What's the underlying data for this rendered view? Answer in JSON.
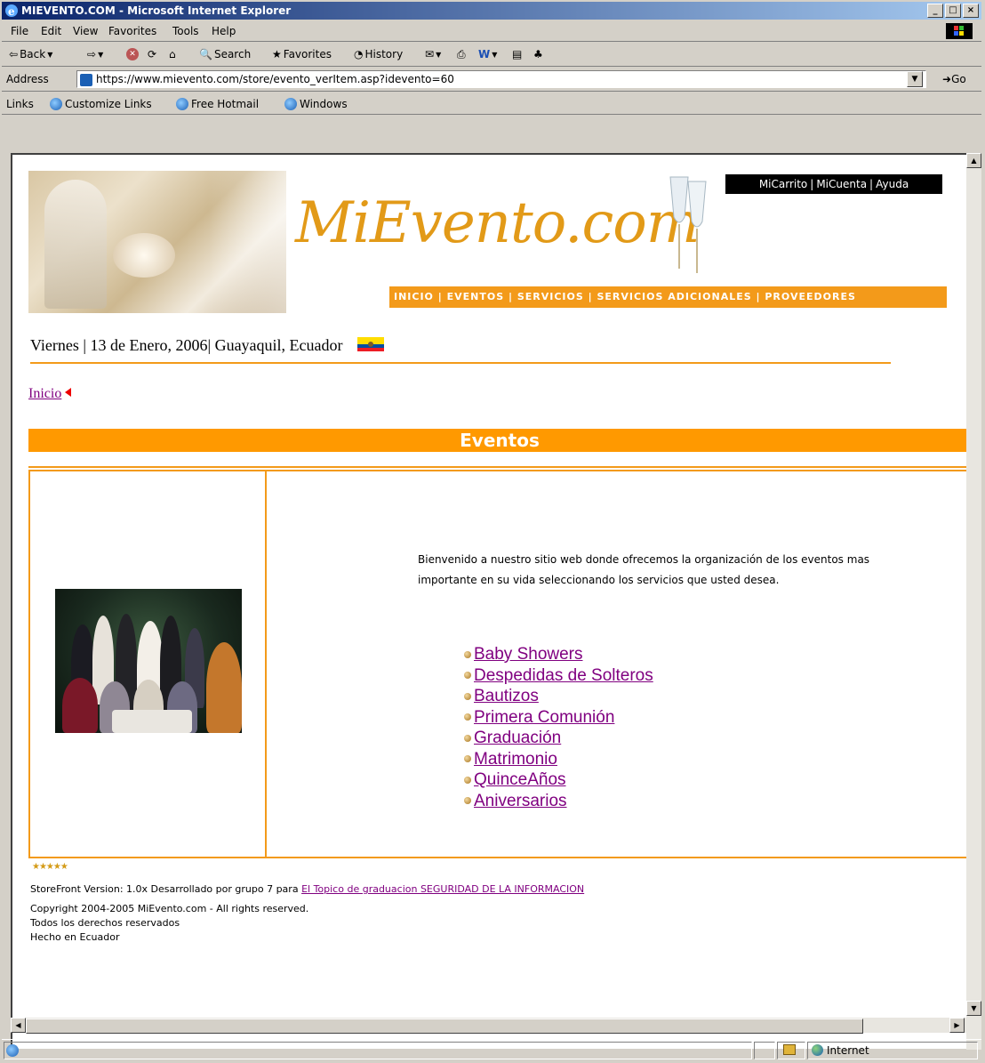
{
  "window": {
    "title": "MIEVENTO.COM - Microsoft Internet Explorer",
    "controls": [
      "_",
      "□",
      "×"
    ]
  },
  "menubar": {
    "items": [
      "File",
      "Edit",
      "View",
      "Favorites",
      "Tools",
      "Help"
    ]
  },
  "toolbar": {
    "back": "Back",
    "search": "Search",
    "favorites": "Favorites",
    "history": "History"
  },
  "address": {
    "label": "Address",
    "url": "https://www.mievento.com/store/evento_verItem.asp?idevento=60",
    "go": "Go"
  },
  "links": {
    "label": "Links",
    "items": [
      "Customize Links",
      "Free Hotmail",
      "Windows"
    ]
  },
  "site": {
    "logo": "MiEvento.com",
    "top_links": [
      "MiCarrito",
      "MiCuenta",
      "Ayuda"
    ],
    "nav": [
      "INICIO",
      "EVENTOS",
      "SERVICIOS",
      "SERVICIOS ADICIONALES",
      "PROVEEDORES"
    ],
    "dateline": "Viernes | 13 de Enero, 2006| Guayaquil, Ecuador",
    "breadcrumb": "Inicio",
    "section_title": "Eventos",
    "welcome_line1": "Bienvenido a nuestro sitio web donde ofrecemos la organización de los eventos mas",
    "welcome_line2": "importante en su vida seleccionando los servicios que usted desea.",
    "events": [
      "Baby Showers",
      "Despedidas de Solteros",
      "Bautizos",
      "Primera Comunión",
      "Graduación",
      "Matrimonio",
      "QuinceAños",
      "Aniversarios"
    ],
    "stars": "★★★★★",
    "footer": {
      "version_prefix": "StoreFront Version: 1.0x Desarrollado por grupo 7 para",
      "version_link": "El Topico de graduacion SEGURIDAD DE LA INFORMACION",
      "copyright": "Copyright 2004-2005 MiEvento.com - All rights reserved.",
      "rights": "Todos los derechos reservados",
      "made": "Hecho en Ecuador"
    }
  },
  "status": {
    "zone": "Internet"
  },
  "colors": {
    "accent": "#f39a1a",
    "section_bar": "#ff9900",
    "link_visited": "#800080"
  }
}
